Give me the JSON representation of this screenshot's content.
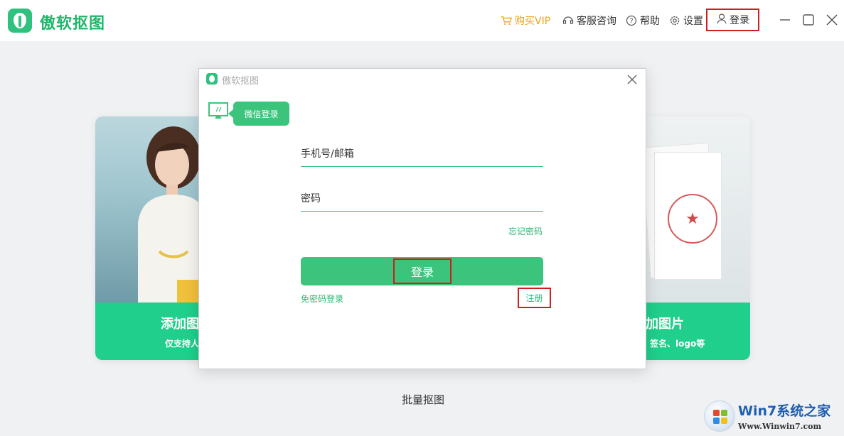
{
  "app": {
    "name": "傲软抠图"
  },
  "topbar": {
    "buy_vip": "购买VIP",
    "support": "客服咨询",
    "help": "帮助",
    "settings": "设置",
    "login": "登录"
  },
  "cards": {
    "left": {
      "title": "添加图",
      "subtitle": "仅支持人"
    },
    "right": {
      "title": "加图片",
      "subtitle": "签名、logo等"
    }
  },
  "batch_label": "批量抠图",
  "dialog": {
    "title": "傲软抠图",
    "wechat_login": "微信登录",
    "phone_email_placeholder": "手机号/邮箱",
    "password_placeholder": "密码",
    "forgot_password": "忘记密码",
    "login_button": "登录",
    "passwordless_login": "免密码登录",
    "register": "注册"
  },
  "watermark": {
    "title": "Win7系统之家",
    "url": "Www.Winwin7.com"
  },
  "colors": {
    "brand_green": "#2ec27e",
    "button_green": "#3cc47c",
    "vip_orange": "#f0a21a",
    "highlight_red": "#cc1f1f",
    "card_band": "#1fcf8b"
  }
}
